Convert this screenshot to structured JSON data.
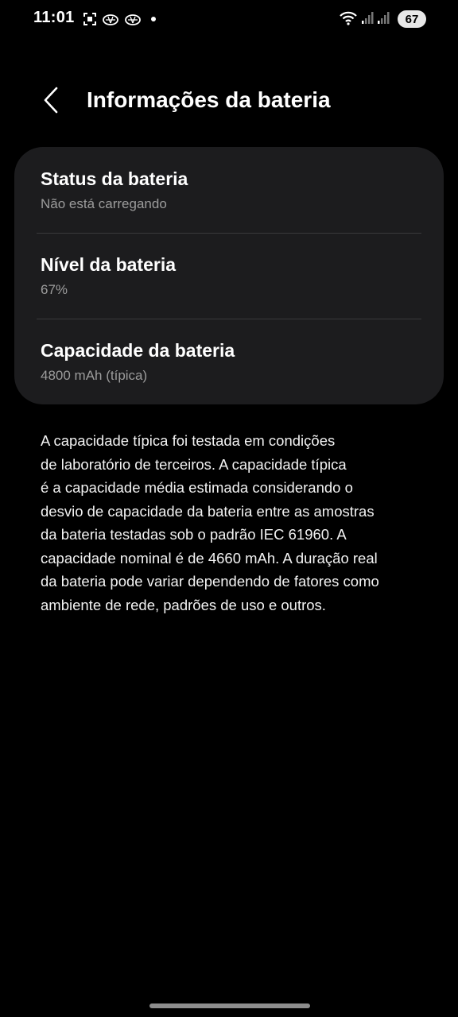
{
  "status_bar": {
    "time": "11:01",
    "battery_level": "67",
    "icons": [
      "screenshot-icon",
      "notification-app-icon",
      "notification-app-icon",
      "dot-icon",
      "wifi-icon",
      "signal-icon",
      "signal-icon"
    ]
  },
  "header": {
    "title": "Informações da bateria",
    "back_icon": "chevron-left-icon"
  },
  "battery_info": {
    "rows": [
      {
        "label": "Status da bateria",
        "value": "Não está carregando"
      },
      {
        "label": "Nível da bateria",
        "value": "67%"
      },
      {
        "label": "Capacidade da bateria",
        "value": "4800 mAh (típica)"
      }
    ]
  },
  "description": {
    "lines": [
      "A capacidade típica foi testada em condições",
      "de laboratório de terceiros. A capacidade típica",
      "é a capacidade média estimada considerando o",
      "desvio de capacidade da bateria entre as amostras",
      "da bateria testadas sob o padrão IEC 61960. A",
      "capacidade nominal é de 4660 mAh. A duração real",
      "da bateria pode variar dependendo de fatores como",
      "ambiente de rede, padrões de uso e outros."
    ]
  },
  "colors": {
    "background": "#000000",
    "card": "#1c1c1e",
    "secondary_text": "#9c9c9c",
    "divider": "#3a3a3c"
  }
}
